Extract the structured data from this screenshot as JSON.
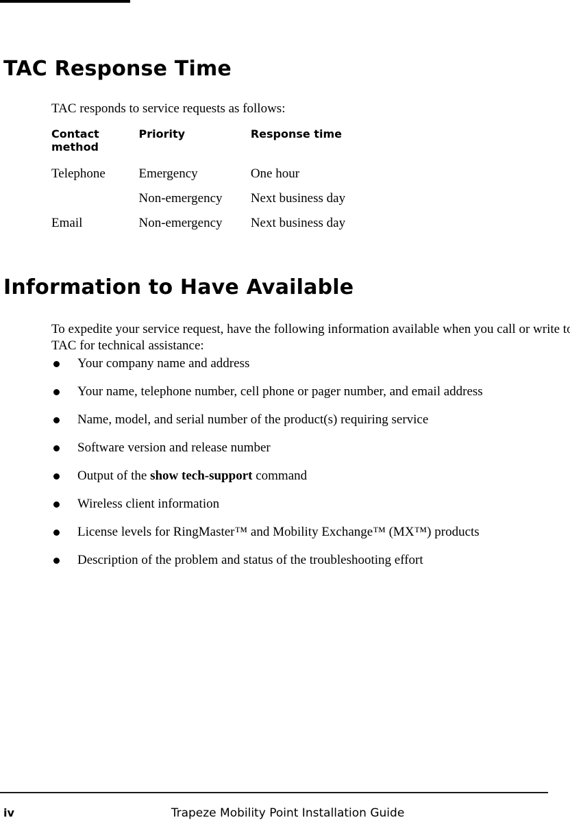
{
  "document": {
    "page_number": "iv",
    "footer_title": "Trapeze Mobility Point Installation Guide"
  },
  "sections": {
    "tac_response": {
      "heading": "TAC Response Time",
      "intro": "TAC responds to service requests as follows:",
      "table": {
        "headers": {
          "contact_method": "Contact\nmethod",
          "priority": "Priority",
          "response_time": "Response time"
        },
        "rows": [
          {
            "contact_method": "Telephone",
            "priority": "Emergency",
            "response_time": "One hour"
          },
          {
            "contact_method": "",
            "priority": "Non-emergency",
            "response_time": "Next business day"
          },
          {
            "contact_method": "Email",
            "priority": "Non-emergency",
            "response_time": "Next business day"
          }
        ]
      }
    },
    "information_available": {
      "heading": "Information to Have Available",
      "intro": "To expedite your service request, have the following information available when you call or write to TAC for technical assistance:",
      "bullets": [
        {
          "text": "Your company name and address"
        },
        {
          "text": "Your name, telephone number, cell phone or pager number, and email address"
        },
        {
          "text": "Name, model, and serial number of the product(s) requiring service"
        },
        {
          "text": "Software version and release number"
        },
        {
          "before": "Output of the ",
          "bold": "show tech-support",
          "after": " command"
        },
        {
          "text": "Wireless client information"
        },
        {
          "text": "License levels for RingMaster™ and Mobility Exchange™ (MX™) products"
        },
        {
          "text": "Description of the problem and status of the troubleshooting effort"
        }
      ]
    }
  },
  "colors": {
    "text": "#000000",
    "rule": "#000000",
    "footer_rule": "#1a1a1a",
    "background": "#ffffff"
  }
}
